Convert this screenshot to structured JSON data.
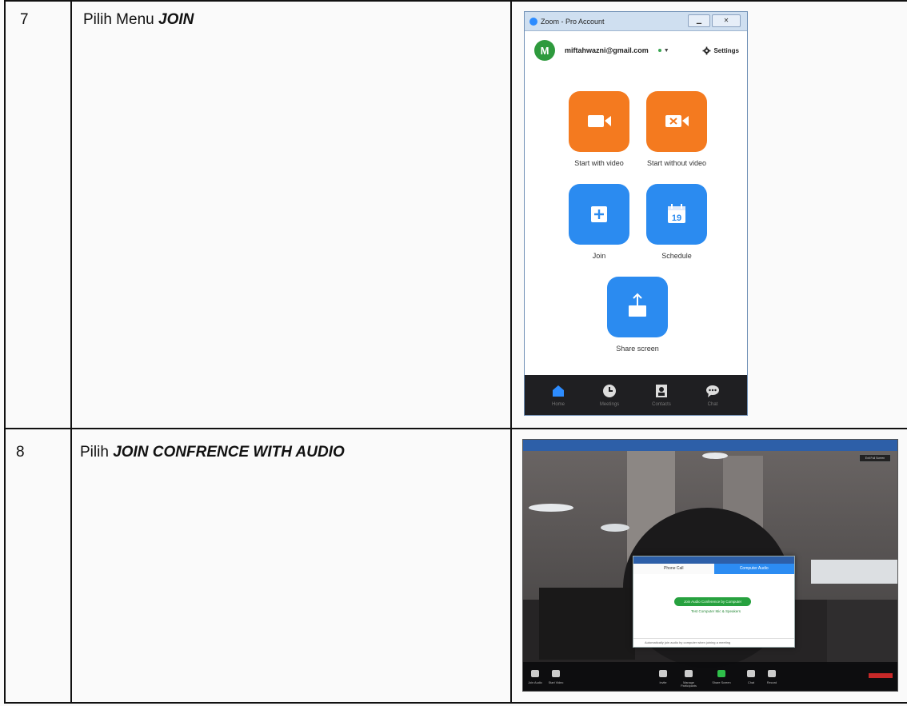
{
  "rows": [
    {
      "number": "7",
      "text_prefix": "Pilih Menu ",
      "text_emphasis": "JOIN"
    },
    {
      "number": "8",
      "text_prefix": "Pilih ",
      "text_emphasis": "JOIN CONFRENCE WITH AUDIO"
    }
  ],
  "zoom_app": {
    "window_title": "Zoom - Pro Account",
    "avatar_letter": "M",
    "email": "miftahwazni@gmail.com",
    "settings_label": "Settings",
    "tiles": [
      {
        "label": "Start with video",
        "icon": "video-camera-icon",
        "color": "#f47a1f"
      },
      {
        "label": "Start without video",
        "icon": "video-off-icon",
        "color": "#f47a1f"
      },
      {
        "label": "Join",
        "icon": "plus-icon",
        "color": "#2b8bf0"
      },
      {
        "label": "Schedule",
        "icon": "calendar-icon",
        "color": "#2b8bf0",
        "calendar_day": "19"
      },
      {
        "label": "Share screen",
        "icon": "share-upload-icon",
        "color": "#2b8bf0"
      }
    ],
    "bottom_nav": [
      {
        "label": "Home",
        "icon": "home-icon"
      },
      {
        "label": "Meetings",
        "icon": "clock-icon"
      },
      {
        "label": "Contacts",
        "icon": "contacts-icon"
      },
      {
        "label": "Chat",
        "icon": "chat-icon"
      }
    ]
  },
  "meeting_screenshot": {
    "exit_label": "Exit Full Screen",
    "dialog": {
      "tab_phone": "Phone Call",
      "tab_computer": "Computer Audio",
      "join_button": "Join Audio Conference by Computer",
      "test_link": "Test Computer Mic & Speakers",
      "footer": "Automatically join audio by computer when joining a meeting"
    },
    "controls": [
      "Join Audio",
      "Start Video",
      "Invite",
      "Manage Participants",
      "Share Screen",
      "Chat",
      "Record"
    ]
  }
}
